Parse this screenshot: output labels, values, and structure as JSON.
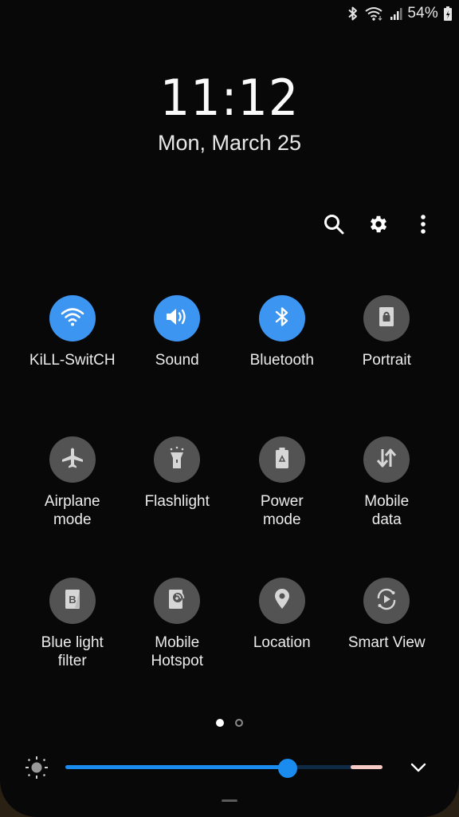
{
  "status_bar": {
    "icons": [
      "bluetooth-icon",
      "wifi-icon",
      "signal-icon",
      "battery-charging-icon"
    ],
    "battery_percent": "54%"
  },
  "clock": {
    "time": "11:12",
    "date": "Mon, March 25"
  },
  "actions": [
    {
      "name": "search",
      "icon": "search-icon"
    },
    {
      "name": "settings",
      "icon": "gear-icon"
    },
    {
      "name": "more-options",
      "icon": "more-vertical-icon"
    }
  ],
  "tiles": [
    {
      "label": "KiLL-SwitCH",
      "icon": "wifi-icon",
      "state": "on"
    },
    {
      "label": "Sound",
      "icon": "volume-icon",
      "state": "on"
    },
    {
      "label": "Bluetooth",
      "icon": "bluetooth-icon",
      "state": "on"
    },
    {
      "label": "Portrait",
      "icon": "portrait-lock-icon",
      "state": "off"
    },
    {
      "label": "Airplane\nmode",
      "icon": "airplane-icon",
      "state": "off"
    },
    {
      "label": "Flashlight",
      "icon": "flashlight-icon",
      "state": "off"
    },
    {
      "label": "Power\nmode",
      "icon": "power-mode-icon",
      "state": "off"
    },
    {
      "label": "Mobile\ndata",
      "icon": "mobile-data-icon",
      "state": "off"
    },
    {
      "label": "Blue light\nfilter",
      "icon": "blue-light-filter-icon",
      "state": "off"
    },
    {
      "label": "Mobile\nHotspot",
      "icon": "hotspot-icon",
      "state": "off"
    },
    {
      "label": "Location",
      "icon": "location-icon",
      "state": "off"
    },
    {
      "label": "Smart View",
      "icon": "smart-view-icon",
      "state": "off"
    }
  ],
  "pagination": {
    "current_page": 1,
    "total_pages": 2
  },
  "brightness": {
    "level": 0.7,
    "outdoor_threshold": 0.9,
    "icon": "brightness-icon"
  },
  "colors": {
    "accent": "#3d95f2",
    "slider": "#1a8cf0",
    "tile_off": "#535353",
    "outdoor_segment": "#f5c9c4",
    "background": "#080808"
  }
}
